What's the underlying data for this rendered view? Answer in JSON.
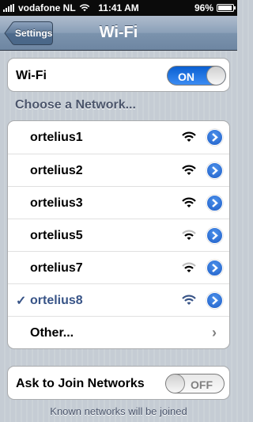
{
  "status_bar": {
    "carrier": "vodafone NL",
    "time": "11:41 AM",
    "battery": "96%",
    "battery_level": 0.96,
    "signal_icon": "signal-bars-icon",
    "wifi_icon": "wifi-icon"
  },
  "nav": {
    "back_label": "Settings",
    "title": "Wi-Fi"
  },
  "wifi_toggle": {
    "label": "Wi-Fi",
    "state": "ON"
  },
  "section_header": "Choose a Network...",
  "networks": [
    {
      "name": "ortelius1",
      "selected": false,
      "signal": 3
    },
    {
      "name": "ortelius2",
      "selected": false,
      "signal": 3
    },
    {
      "name": "ortelius3",
      "selected": false,
      "signal": 3
    },
    {
      "name": "ortelius5",
      "selected": false,
      "signal": 2
    },
    {
      "name": "ortelius7",
      "selected": false,
      "signal": 2
    },
    {
      "name": "ortelius8",
      "selected": true,
      "signal": 3
    }
  ],
  "other_label": "Other...",
  "ask_join": {
    "label": "Ask to Join Networks",
    "state": "OFF"
  },
  "footer_text": "Known networks will be joined",
  "colors": {
    "selected_text": "#385487",
    "toggle_on": "#1a6fe0",
    "info_button": "#2a6ad6"
  }
}
